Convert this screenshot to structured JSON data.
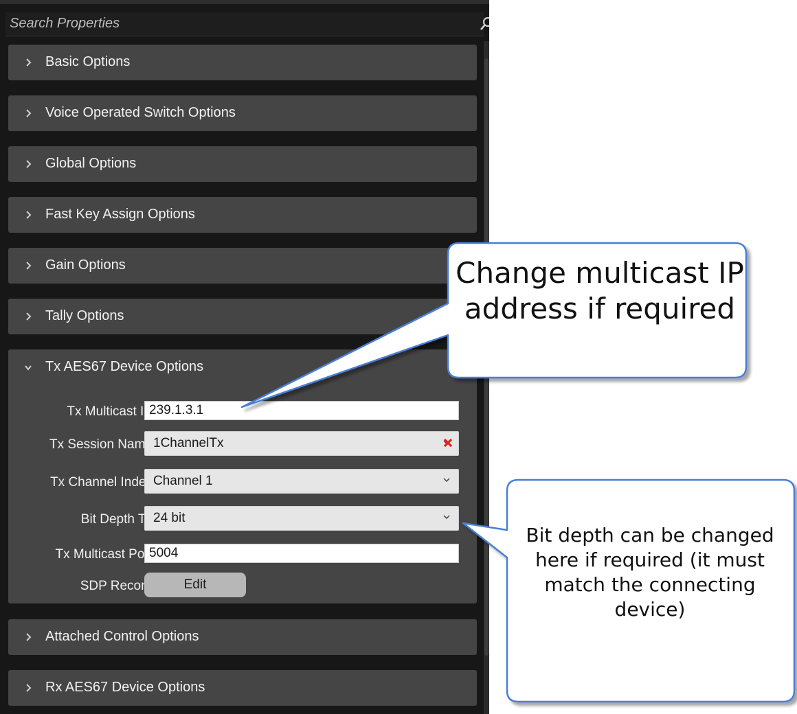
{
  "search": {
    "placeholder": "Search Properties",
    "icon": "search-icon"
  },
  "sections": [
    {
      "label": "Basic Options",
      "expanded": false
    },
    {
      "label": "Voice Operated Switch Options",
      "expanded": false
    },
    {
      "label": "Global Options",
      "expanded": false
    },
    {
      "label": "Fast Key Assign Options",
      "expanded": false
    },
    {
      "label": "Gain Options",
      "expanded": false
    },
    {
      "label": "Tally Options",
      "expanded": false
    },
    {
      "label": "Tx AES67 Device Options",
      "expanded": true
    },
    {
      "label": "Attached Control Options",
      "expanded": false
    },
    {
      "label": "Rx AES67 Device Options",
      "expanded": false
    }
  ],
  "tx_options": {
    "multicast_ip": {
      "label": "Tx Multicast IP",
      "value": "239.1.3.1"
    },
    "session_name": {
      "label": "Tx Session Name",
      "value": "1ChannelTx"
    },
    "channel_index": {
      "label": "Tx Channel Index",
      "value": "Channel 1"
    },
    "bit_depth": {
      "label": "Bit Depth Tx",
      "value": "24 bit"
    },
    "multicast_port": {
      "label": "Tx Multicast Port",
      "value": "5004"
    },
    "sdp_record": {
      "label": "SDP Record",
      "button": "Edit"
    }
  },
  "callouts": {
    "ip": "Change multicast IP address if required",
    "bit_depth": "Bit depth can be changed here if required (it must match the connecting device)"
  },
  "colors": {
    "panel_bg": "#171717",
    "section_bg": "#454545",
    "callout_border": "#4a7fd6",
    "remove_icon": "#e02020"
  }
}
